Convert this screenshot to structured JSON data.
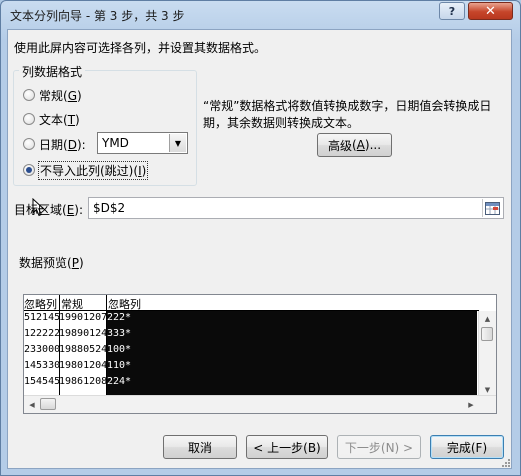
{
  "window": {
    "title": "文本分列向导 - 第 3 步，共 3 步",
    "help_label": "?",
    "close_label": "✕"
  },
  "instruction": "使用此屏内容可选择各列，并设置其数据格式。",
  "column_format": {
    "group_label": "列数据格式",
    "options": [
      {
        "name": "常规",
        "hotkey": "G",
        "checked": false
      },
      {
        "name": "文本",
        "hotkey": "T",
        "checked": false
      },
      {
        "name": "日期",
        "hotkey": "D",
        "checked": false
      },
      {
        "name": "不导入此列(跳过)",
        "hotkey": "I",
        "checked": true
      }
    ],
    "date_format": "YMD"
  },
  "description": "“常规”数据格式将数值转换成数字，日期值会转换成日期，其余数据则转换成文本。",
  "advanced_button": {
    "name": "高级",
    "hotkey": "A",
    "suffix": "..."
  },
  "destination": {
    "label": "目标区域",
    "hotkey": "E",
    "value": "$D$2"
  },
  "preview": {
    "label": "数据预览",
    "hotkey": "P",
    "headers": [
      "忽略列",
      "常规",
      "忽略列"
    ],
    "rows": [
      [
        "512145",
        "19901207",
        "222*"
      ],
      [
        "122222",
        "19890124",
        "333*"
      ],
      [
        "233000",
        "19880524",
        "100*"
      ],
      [
        "145330",
        "19801204",
        "110*"
      ],
      [
        "154545",
        "19861208",
        "224*"
      ]
    ]
  },
  "buttons": {
    "cancel": "取消",
    "back": "< 上一步(B)",
    "next": "下一步(N) >",
    "finish": "完成(F)"
  },
  "colors": {
    "title_bar": "#c9dcf0",
    "close_button": "#c6452a",
    "selected_column_bg": "#0a0a0a",
    "dialog_bg": "#f0f0f0"
  }
}
